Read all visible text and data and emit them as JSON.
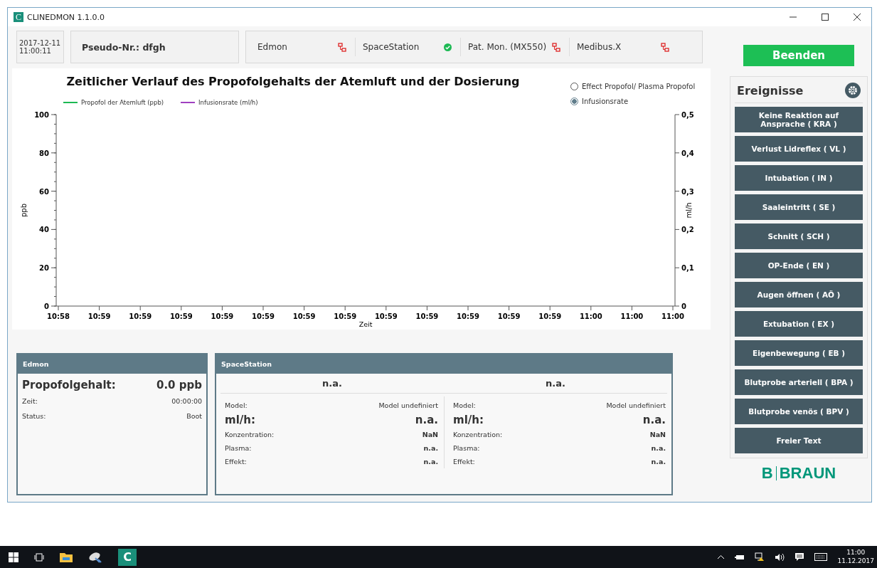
{
  "window": {
    "title": "CLINEDMON 1.1.0.0",
    "app_icon_letter": "C"
  },
  "header": {
    "datetime": [
      "2017-12-11",
      "11:00:11"
    ],
    "pseudo_label": "Pseudo-Nr.:",
    "pseudo_value": "dfgh",
    "devices": [
      {
        "name": "Edmon",
        "connected": false
      },
      {
        "name": "SpaceStation",
        "connected": true
      },
      {
        "name": "Pat. Mon. (MX550)",
        "connected": false
      },
      {
        "name": "Medibus.X",
        "connected": false
      }
    ]
  },
  "quit_button": "Beenden",
  "chart_panel": {
    "options": [
      {
        "label": "Effect Propofol/ Plasma Propofol",
        "selected": false
      },
      {
        "label": "Infusionsrate",
        "selected": true
      }
    ],
    "chart_data": {
      "type": "line",
      "title": "Zeitlicher Verlauf des Propofolgehalts der Atemluft und der Dosierung",
      "xlabel": "Zeit",
      "ylabel": "ppb",
      "y2label": "ml/h",
      "categories": [
        "10:58",
        "10:59",
        "10:59",
        "10:59",
        "10:59",
        "10:59",
        "10:59",
        "10:59",
        "10:59",
        "10:59",
        "10:59",
        "10:59",
        "10:59",
        "11:00",
        "11:00",
        "11:00"
      ],
      "ylim": [
        0,
        100
      ],
      "y2lim": [
        0,
        0.5
      ],
      "yticks": [
        0,
        20,
        40,
        60,
        80,
        100
      ],
      "y2ticks": [
        {
          "value": 0,
          "label": "0"
        },
        {
          "value": 0.1,
          "label": "0,1"
        },
        {
          "value": 0.2,
          "label": "0,2"
        },
        {
          "value": 0.3,
          "label": "0,3"
        },
        {
          "value": 0.4,
          "label": "0,4"
        },
        {
          "value": 0.5,
          "label": "0,5"
        }
      ],
      "series": [
        {
          "name": "Propofol der Atemluft (ppb)",
          "color": "#1db954",
          "values": [
            null,
            null,
            null,
            null,
            null,
            null,
            null,
            null,
            null,
            null,
            null,
            null,
            null,
            null,
            null,
            null
          ]
        },
        {
          "name": "Infusionsrate (ml/h)",
          "color": "#a040c0",
          "values": [
            null,
            null,
            null,
            null,
            null,
            null,
            null,
            null,
            null,
            null,
            null,
            null,
            null,
            null,
            null,
            null
          ]
        }
      ]
    }
  },
  "edmon_panel": {
    "title": "Edmon",
    "main_label": "Propofolgehalt:",
    "main_value": "0.0 ppb",
    "rows": [
      {
        "label": "Zeit:",
        "value": "00:00:00"
      },
      {
        "label": "Status:",
        "value": "Boot"
      }
    ]
  },
  "spacestation_panel": {
    "title": "SpaceStation",
    "pumps": [
      {
        "headline": "n.a.",
        "model_label": "Model:",
        "model_value": "Model undefiniert",
        "rate_label": "ml/h:",
        "rate_value": "n.a.",
        "rows": [
          {
            "label": "Konzentration:",
            "value": "NaN"
          },
          {
            "label": "Plasma:",
            "value": "n.a."
          },
          {
            "label": "Effekt:",
            "value": "n.a."
          }
        ]
      },
      {
        "headline": "n.a.",
        "model_label": "Model:",
        "model_value": "Model undefiniert",
        "rate_label": "ml/h:",
        "rate_value": "n.a.",
        "rows": [
          {
            "label": "Konzentration:",
            "value": "NaN"
          },
          {
            "label": "Plasma:",
            "value": "n.a."
          },
          {
            "label": "Effekt:",
            "value": "n.a."
          }
        ]
      }
    ]
  },
  "events_panel": {
    "title": "Ereignisse",
    "buttons": [
      "Keine Reaktion auf Ansprache ( KRA )",
      "Verlust Lidreflex ( VL )",
      "Intubation ( IN )",
      "Saaleintritt ( SE )",
      "Schnitt ( SCH )",
      "OP-Ende ( EN )",
      "Augen öffnen ( AÖ )",
      "Extubation ( EX )",
      "Eigenbewegung ( EB )",
      "Blutprobe arteriell ( BPA )",
      "Blutprobe venös ( BPV )",
      "Freier Text"
    ]
  },
  "logo": {
    "left": "B",
    "right": "BRAUN"
  },
  "taskbar": {
    "app_letter": "C",
    "time": "11:00",
    "date": "11.12.2017"
  }
}
